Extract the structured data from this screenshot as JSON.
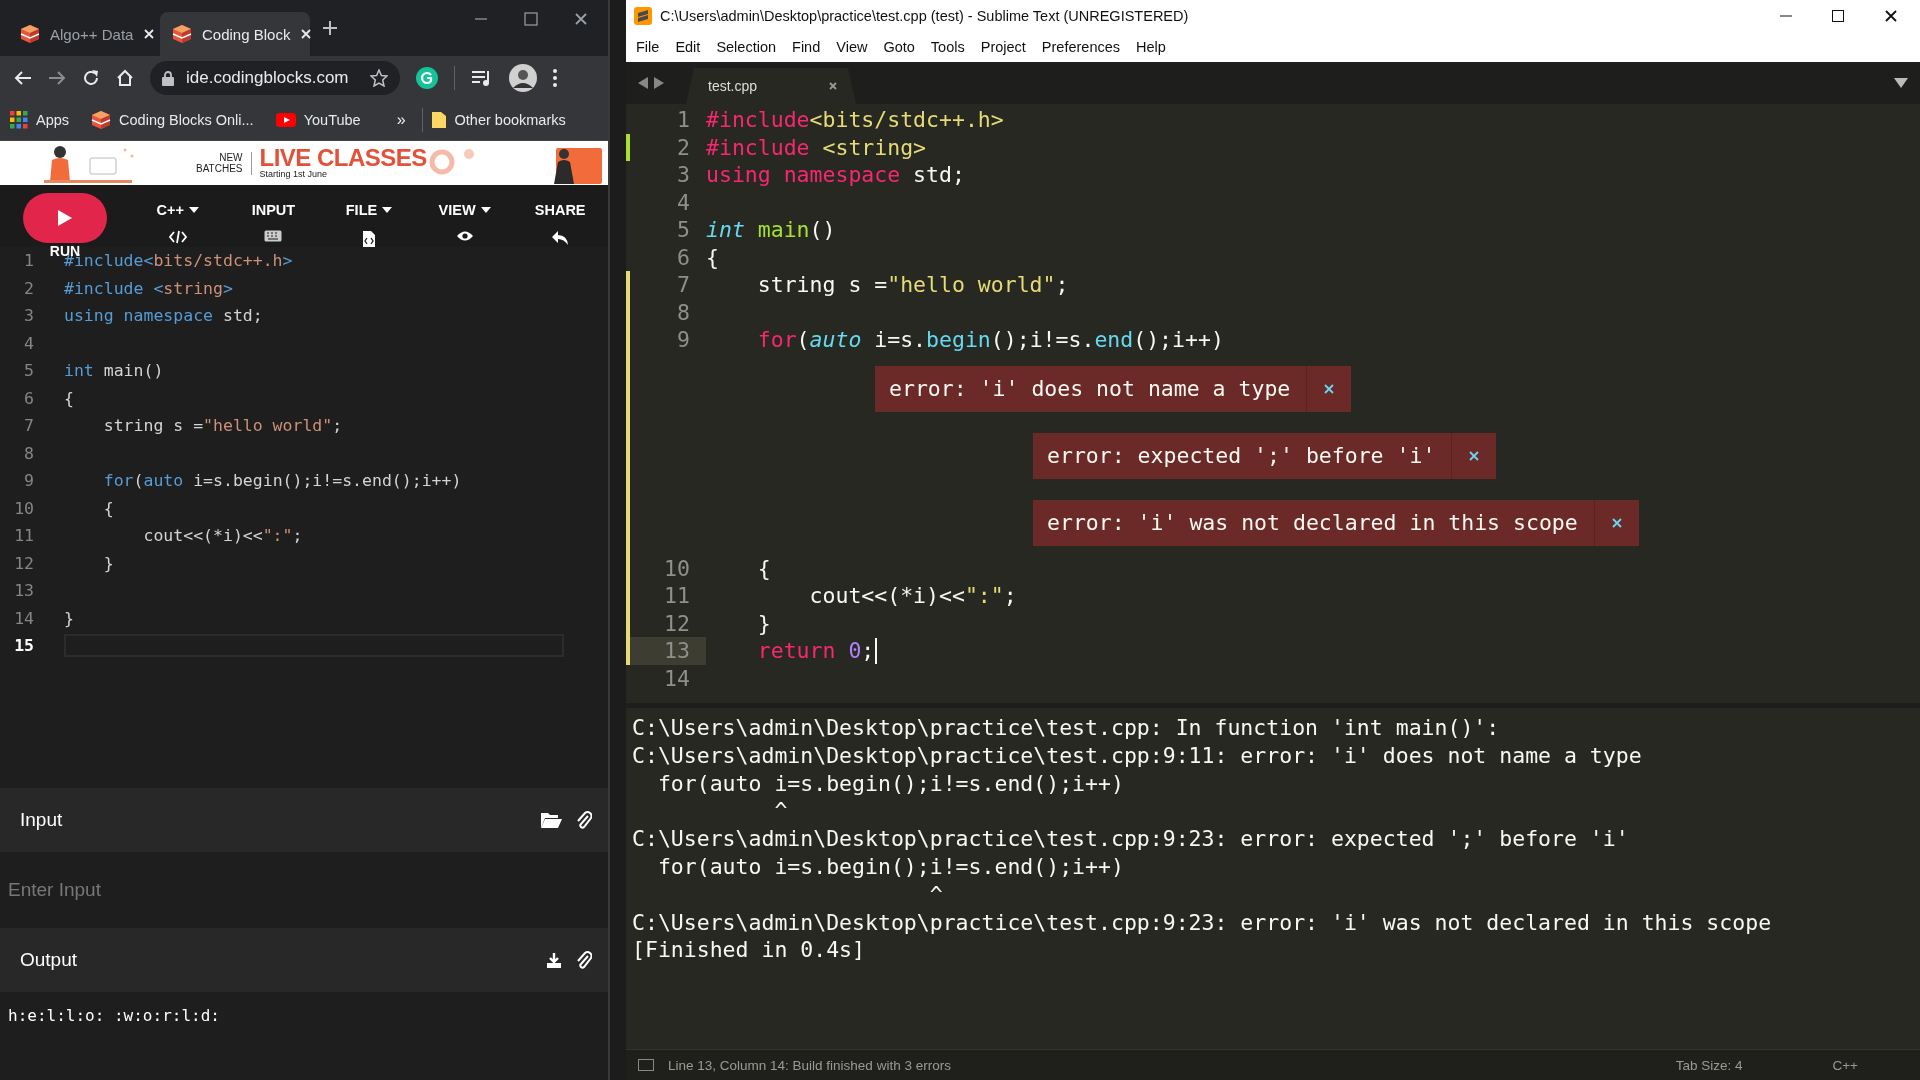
{
  "browser": {
    "tabs": [
      {
        "title": "Algo++ Data",
        "selected": false
      },
      {
        "title": "Coding Block",
        "selected": true
      }
    ],
    "address": "ide.codingblocks.com",
    "bookmarks": [
      {
        "label": "Apps",
        "kind": "apps"
      },
      {
        "label": "Coding Blocks Onli...",
        "kind": "site"
      },
      {
        "label": "YouTube",
        "kind": "video"
      }
    ],
    "bookmarks_overflow": "»",
    "other_bookmarks": "Other bookmarks",
    "banner": {
      "tag_top": "NEW",
      "tag_bottom": "BATCHES",
      "headline": "LIVE CLASSES",
      "subline": "Starting 1st June"
    }
  },
  "ide": {
    "run": "RUN",
    "menu": [
      {
        "label": "C++",
        "kind": "language",
        "dropdown": true
      },
      {
        "label": "INPUT",
        "kind": "input",
        "dropdown": false
      },
      {
        "label": "FILE",
        "kind": "file",
        "dropdown": true
      },
      {
        "label": "VIEW",
        "kind": "view",
        "dropdown": true
      },
      {
        "label": "SHARE",
        "kind": "share",
        "dropdown": false
      }
    ],
    "lines": [
      {
        "number": "1",
        "current": false,
        "tokens": [
          {
            "kind": "keyword",
            "text": "#include<"
          },
          {
            "kind": "string",
            "text": "bits/stdc++.h"
          },
          {
            "kind": "keyword",
            "text": ">"
          }
        ]
      },
      {
        "number": "2",
        "current": false,
        "tokens": [
          {
            "kind": "keyword",
            "text": "#include <"
          },
          {
            "kind": "string",
            "text": "string"
          },
          {
            "kind": "keyword",
            "text": ">"
          }
        ]
      },
      {
        "number": "3",
        "current": false,
        "tokens": [
          {
            "kind": "keyword",
            "text": "using namespace"
          },
          {
            "kind": "plain",
            "text": " std;"
          }
        ]
      },
      {
        "number": "4",
        "current": false
      },
      {
        "number": "5",
        "current": false,
        "tokens": [
          {
            "kind": "keyword",
            "text": "int"
          },
          {
            "kind": "plain",
            "text": " main()"
          }
        ]
      },
      {
        "number": "6",
        "current": false,
        "tokens": [
          {
            "kind": "plain",
            "text": "{"
          }
        ]
      },
      {
        "number": "7",
        "current": false,
        "tokens": [
          {
            "kind": "plain",
            "text": "    string s ="
          },
          {
            "kind": "string",
            "text": "\"hello world\""
          },
          {
            "kind": "plain",
            "text": ";"
          }
        ]
      },
      {
        "number": "8",
        "current": false
      },
      {
        "number": "9",
        "current": false,
        "tokens": [
          {
            "kind": "keyword",
            "text": "    for"
          },
          {
            "kind": "plain",
            "text": "("
          },
          {
            "kind": "keyword",
            "text": "auto"
          },
          {
            "kind": "plain",
            "text": " i=s.begin();i!=s.end();i++)"
          }
        ]
      },
      {
        "number": "10",
        "current": false,
        "tokens": [
          {
            "kind": "plain",
            "text": "    {"
          }
        ]
      },
      {
        "number": "11",
        "current": false,
        "tokens": [
          {
            "kind": "plain",
            "text": "        cout<<(*i)<<"
          },
          {
            "kind": "string",
            "text": "\":\""
          },
          {
            "kind": "plain",
            "text": ";"
          }
        ]
      },
      {
        "number": "12",
        "current": false,
        "tokens": [
          {
            "kind": "plain",
            "text": "    }"
          }
        ]
      },
      {
        "number": "13",
        "current": false
      },
      {
        "number": "14",
        "current": false,
        "tokens": [
          {
            "kind": "plain",
            "text": "}"
          }
        ]
      },
      {
        "number": "15",
        "current": true
      }
    ],
    "input": {
      "title": "Input",
      "placeholder": "Enter Input"
    },
    "output": {
      "title": "Output",
      "text": "h:e:l:l:o: :w:o:r:l:d:"
    }
  },
  "sublime": {
    "title": "C:\\Users\\admin\\Desktop\\practice\\test.cpp (test) - Sublime Text (UNREGISTERED)",
    "menu": [
      "File",
      "Edit",
      "Selection",
      "Find",
      "View",
      "Goto",
      "Tools",
      "Project",
      "Preferences",
      "Help"
    ],
    "tabs": [
      {
        "title": "test.cpp",
        "selected": true
      }
    ],
    "rows": [
      {
        "kind": "code",
        "number": "1",
        "current": false,
        "tokens": [
          {
            "kind": "keyword",
            "text": "#include"
          },
          {
            "kind": "string",
            "text": "<bits/stdc++.h>"
          }
        ]
      },
      {
        "kind": "code",
        "number": "2",
        "current": false,
        "color": "#a6e22e",
        "tokens": [
          {
            "kind": "keyword",
            "text": "#include "
          },
          {
            "kind": "string",
            "text": "<string>"
          }
        ]
      },
      {
        "kind": "code",
        "number": "3",
        "current": false,
        "tokens": [
          {
            "kind": "keyword",
            "text": "using "
          },
          {
            "kind": "keyword",
            "text": "namespace"
          },
          {
            "kind": "plain",
            "text": " std;"
          }
        ]
      },
      {
        "kind": "code",
        "number": "4",
        "current": false
      },
      {
        "kind": "code",
        "number": "5",
        "current": false,
        "tokens": [
          {
            "kind": "type",
            "text": "int"
          },
          {
            "kind": "function",
            "text": " main"
          },
          {
            "kind": "plain",
            "text": "()"
          }
        ]
      },
      {
        "kind": "code",
        "number": "6",
        "current": false,
        "tokens": [
          {
            "kind": "plain",
            "text": "{"
          }
        ]
      },
      {
        "kind": "code",
        "number": "7",
        "current": false,
        "color": "#e6db74",
        "tokens": [
          {
            "kind": "plain",
            "text": "    string s ="
          },
          {
            "kind": "string",
            "text": "\"hello world\""
          },
          {
            "kind": "plain",
            "text": ";"
          }
        ]
      },
      {
        "kind": "code",
        "number": "8",
        "current": false,
        "color": "#e6db74"
      },
      {
        "kind": "code",
        "number": "9",
        "current": false,
        "color": "#e6db74",
        "tokens": [
          {
            "kind": "keyword",
            "text": "    for"
          },
          {
            "kind": "plain",
            "text": "("
          },
          {
            "kind": "type",
            "text": "auto"
          },
          {
            "kind": "plain",
            "text": " i=s."
          },
          {
            "kind": "call",
            "text": "begin"
          },
          {
            "kind": "plain",
            "text": "();i!=s."
          },
          {
            "kind": "call",
            "text": "end"
          },
          {
            "kind": "plain",
            "text": "();i++)"
          }
        ]
      },
      {
        "kind": "error",
        "color": "#e6db74",
        "text": "error: 'i' does not name a type"
      },
      {
        "kind": "error",
        "color": "#e6db74",
        "text": "error: expected ';' before 'i'"
      },
      {
        "kind": "error",
        "color": "#e6db74",
        "text": "error: 'i' was not declared in this scope"
      },
      {
        "kind": "code",
        "number": "10",
        "current": false,
        "color": "#e6db74",
        "tokens": [
          {
            "kind": "plain",
            "text": "    {"
          }
        ]
      },
      {
        "kind": "code",
        "number": "11",
        "current": false,
        "color": "#e6db74",
        "tokens": [
          {
            "kind": "plain",
            "text": "        cout<<(*i)<<"
          },
          {
            "kind": "string",
            "text": "\":\""
          },
          {
            "kind": "plain",
            "text": ";"
          }
        ]
      },
      {
        "kind": "code",
        "number": "12",
        "current": false,
        "color": "#e6db74",
        "tokens": [
          {
            "kind": "plain",
            "text": "    }"
          }
        ]
      },
      {
        "kind": "code",
        "number": "13",
        "current": true,
        "cursor": true,
        "color": "#e6db74",
        "tokens": [
          {
            "kind": "keyword",
            "text": "    return "
          },
          {
            "kind": "number",
            "text": "0"
          },
          {
            "kind": "plain",
            "text": ";"
          }
        ]
      },
      {
        "kind": "code",
        "number": "14",
        "current": false
      }
    ],
    "console": [
      "C:\\Users\\admin\\Desktop\\practice\\test.cpp: In function 'int main()':",
      "C:\\Users\\admin\\Desktop\\practice\\test.cpp:9:11: error: 'i' does not name a type",
      "  for(auto i=s.begin();i!=s.end();i++)",
      "           ^",
      "C:\\Users\\admin\\Desktop\\practice\\test.cpp:9:23: error: expected ';' before 'i'",
      "  for(auto i=s.begin();i!=s.end();i++)",
      "                       ^",
      "C:\\Users\\admin\\Desktop\\practice\\test.cpp:9:23: error: 'i' was not declared in this scope",
      "[Finished in 0.4s]"
    ],
    "status": {
      "message": "Line 13, Column 14: Build finished with 3 errors",
      "tab_size": "Tab Size: 4",
      "syntax": "C++"
    }
  }
}
